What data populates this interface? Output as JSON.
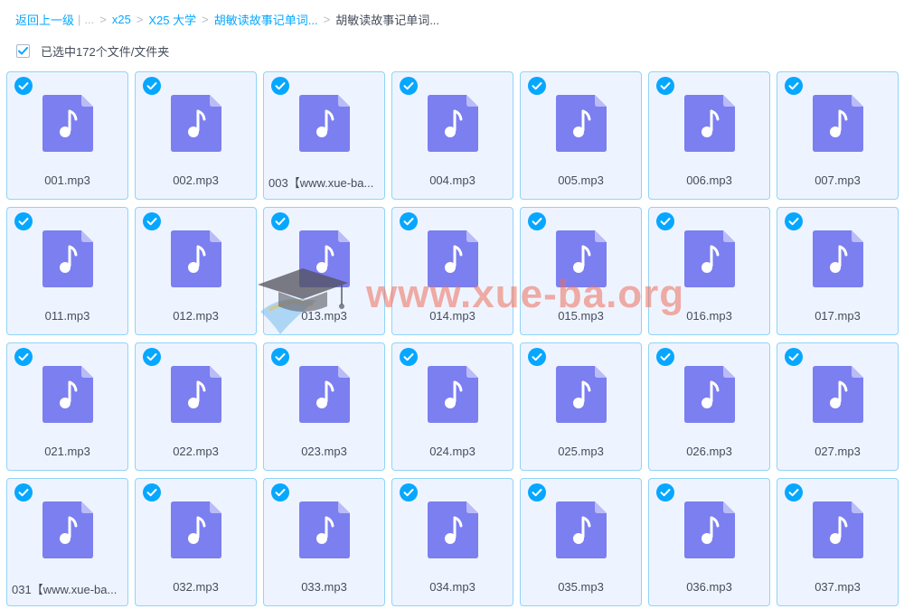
{
  "breadcrumb": {
    "back_label": "返回上一级",
    "pipe": "|",
    "ellipsis": "...",
    "crumbs": [
      "x25",
      "X25 大学",
      "胡敏读故事记单词..."
    ],
    "current": "胡敏读故事记单词...",
    "separator": ">"
  },
  "selection": {
    "label": "已选中172个文件/文件夹",
    "checked": true
  },
  "files": [
    "001.mp3",
    "002.mp3",
    "003【www.xue-ba...",
    "004.mp3",
    "005.mp3",
    "006.mp3",
    "007.mp3",
    "011.mp3",
    "012.mp3",
    "013.mp3",
    "014.mp3",
    "015.mp3",
    "016.mp3",
    "017.mp3",
    "021.mp3",
    "022.mp3",
    "023.mp3",
    "024.mp3",
    "025.mp3",
    "026.mp3",
    "027.mp3",
    "031【www.xue-ba...",
    "032.mp3",
    "033.mp3",
    "034.mp3",
    "035.mp3",
    "036.mp3",
    "037.mp3"
  ],
  "watermark": {
    "text": "www.xue-ba.org"
  },
  "colors": {
    "accent": "#06a7ff",
    "tile_bg": "#eef4ff",
    "tile_border": "#8fd4f7",
    "audio_icon": "#7b7ff0",
    "text": "#454d5a"
  },
  "icons": {
    "tile_check": "check-circle-icon",
    "file_type": "audio-file-icon"
  }
}
